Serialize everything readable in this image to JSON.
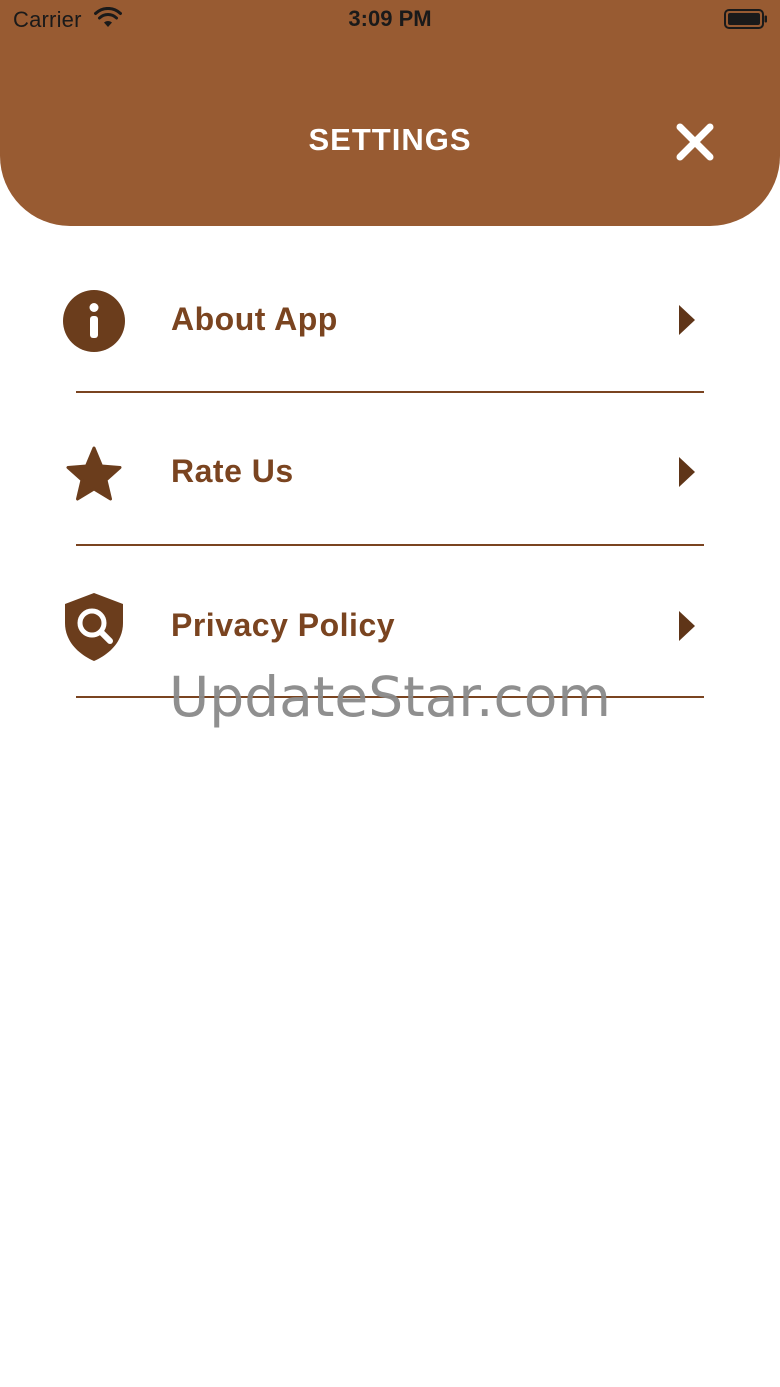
{
  "status_bar": {
    "carrier": "Carrier",
    "time": "3:09 PM",
    "wifi_icon": "wifi-icon",
    "battery_icon": "battery-icon"
  },
  "header": {
    "title": "SETTINGS",
    "close_icon": "close-icon",
    "background_color": "#985b32"
  },
  "menu": {
    "items": [
      {
        "label": "About App",
        "icon": "info-icon"
      },
      {
        "label": "Rate Us",
        "icon": "star-icon"
      },
      {
        "label": "Privacy Policy",
        "icon": "shield-search-icon"
      }
    ],
    "chevron_icon": "chevron-right-icon",
    "accent_color": "#7a4420"
  },
  "watermark": "UpdateStar.com"
}
